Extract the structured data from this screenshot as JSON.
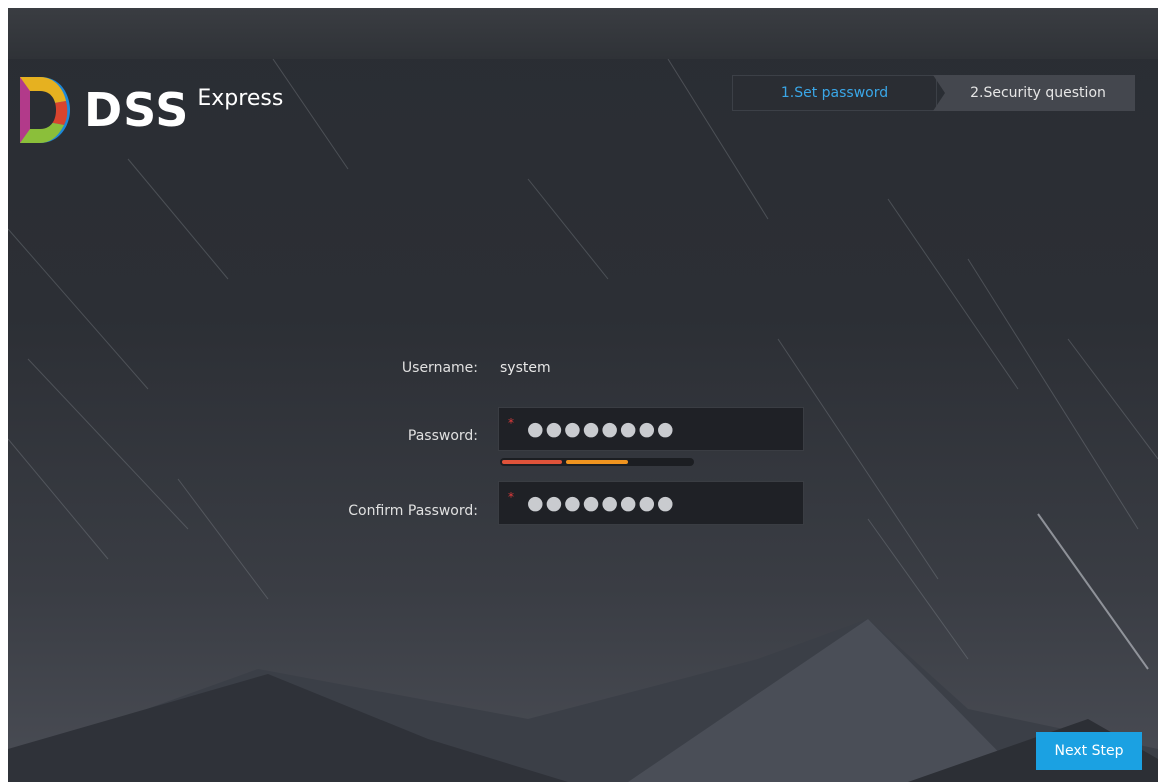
{
  "app": {
    "logo_main": "DSS",
    "logo_sub": "Express"
  },
  "steps": {
    "step1": "1.Set password",
    "step2": "2.Security question"
  },
  "form": {
    "username_label": "Username:",
    "username_value": "system",
    "password_label": "Password:",
    "password_mask": "●●●●●●●●",
    "confirm_label": "Confirm Password:",
    "confirm_mask": "●●●●●●●●",
    "required_mark": "*",
    "strength_level": 0.66
  },
  "actions": {
    "next_label": "Next Step"
  },
  "colors": {
    "accent": "#1ba1e2",
    "active_step": "#3aa7e8",
    "strength_red": "#e0533a",
    "strength_orange": "#f0941f"
  }
}
